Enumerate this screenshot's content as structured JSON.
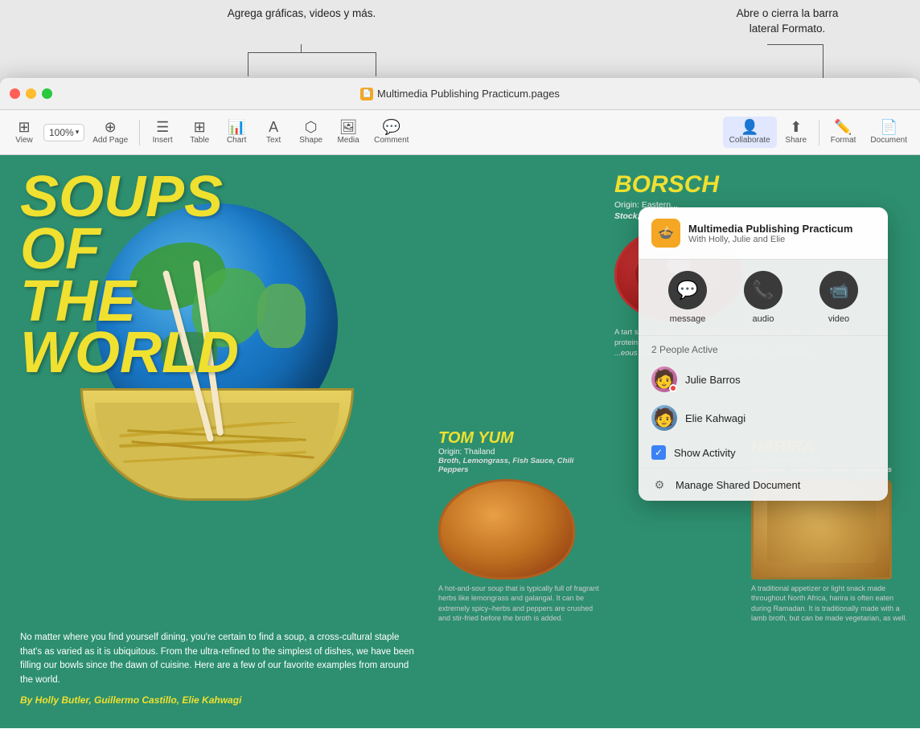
{
  "annotations": {
    "multimedia_callout": "Agrega gráficas,\nvideos y más.",
    "format_callout": "Abre o cierra la barra\nlateral Formato."
  },
  "titlebar": {
    "title": "Multimedia Publishing Practicum.pages",
    "icon": "📄"
  },
  "toolbar": {
    "view_label": "View",
    "zoom_value": "100%",
    "add_page_label": "Add Page",
    "insert_label": "Insert",
    "table_label": "Table",
    "chart_label": "Chart",
    "text_label": "Text",
    "shape_label": "Shape",
    "media_label": "Media",
    "comment_label": "Comment",
    "collaborate_label": "Collaborate",
    "share_label": "Share",
    "format_label": "Format",
    "document_label": "Document"
  },
  "popup": {
    "doc_title": "Multimedia Publishing Practicum",
    "doc_subtitle": "With Holly, Julie and Elie",
    "message_label": "message",
    "audio_label": "audio",
    "video_label": "video",
    "people_active": "2 People Active",
    "person1": "Julie Barros",
    "person2": "Elie Kahwagi",
    "show_activity": "Show Activity",
    "manage_label": "Manage Shared Document"
  },
  "document": {
    "main_title_line1": "SOUPS",
    "main_title_line2": "OF",
    "main_title_line3": "THE",
    "main_title_line4": "WORLD",
    "body_text": "No matter where you find yourself dining, you're certain to find a soup, a cross-cultural staple that's as varied as it is ubiquitous. From the ultra-refined to the simplest of dishes, we have been filling our bowls since the dawn of cuisine. Here are a few of our favorite examples from around the world.",
    "author": "By Holly Butler, Guillermo Castillo, Elie Kahwagi",
    "borscht_name": "BORS",
    "borscht_origin": "Origin: Eastern...",
    "borscht_ingredients": "Stock, Beets, Ve...",
    "borscht_desc": "A tart soup, serv...",
    "tom_yum_name": "TOM YUM",
    "tom_yum_origin": "Origin: Thailand",
    "tom_yum_ingredients": "Broth, Lemongrass, Fish Sauce, Chili Peppers",
    "tom_yum_desc": "A hot-and-sour soup that is typically full of fragrant herbs like lemongrass and galangal. It can be extremely spicy–herbs and peppers are crushed and stir-fried before the broth is added.",
    "harira_name": "HARIRA",
    "harira_origin": "Origin: North Africa",
    "harira_ingredients": "Legumes, Tomatoes, Flour, Vegetables",
    "harira_desc": "A traditional appetizer or light snack made throughout North Africa, harira is often eaten during Ramadan. It is traditionally made with a lamb broth, but can be made vegetarian, as well."
  }
}
